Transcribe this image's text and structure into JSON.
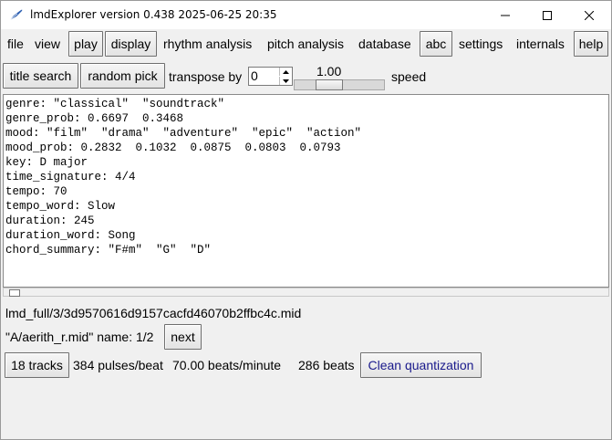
{
  "window": {
    "title": "lmdExplorer version 0.438 2025-06-25 20:35"
  },
  "menubar": {
    "file": "file",
    "view": "view",
    "play": "play",
    "display": "display",
    "rhythm": "rhythm analysis",
    "pitch": "pitch analysis",
    "database": "database",
    "abc": "abc",
    "settings": "settings",
    "internals": "internals",
    "help": "help"
  },
  "toolbar": {
    "title_search": "title search",
    "random_pick": "random pick",
    "transpose_label": "transpose by",
    "transpose_value": "0",
    "speed_value": "1.00",
    "speed_label": "speed"
  },
  "output": {
    "lines": [
      "genre: \"classical\"  \"soundtrack\"",
      "genre_prob: 0.6697  0.3468",
      "mood: \"film\"  \"drama\"  \"adventure\"  \"epic\"  \"action\"",
      "mood_prob: 0.2832  0.1032  0.0875  0.0803  0.0793",
      "key: D major",
      "time_signature: 4/4",
      "tempo: 70",
      "tempo_word: Slow",
      "duration: 245",
      "duration_word: Song",
      "chord_summary: \"F#m\"  \"G\"  \"D\""
    ]
  },
  "file": {
    "path": "lmd_full/3/3d9570616d9157cacfd46070b2ffbc4c.mid",
    "alias": "\"A/aerith_r.mid\"  name: 1/2",
    "next_label": "next"
  },
  "stats": {
    "tracks": "18 tracks",
    "ppq": "384 pulses/beat",
    "tempo": "70.00 beats/minute",
    "beats": "286 beats",
    "clean_quantization": "Clean quantization"
  },
  "colors": {
    "accent_button_text": "#1a1a8c"
  }
}
